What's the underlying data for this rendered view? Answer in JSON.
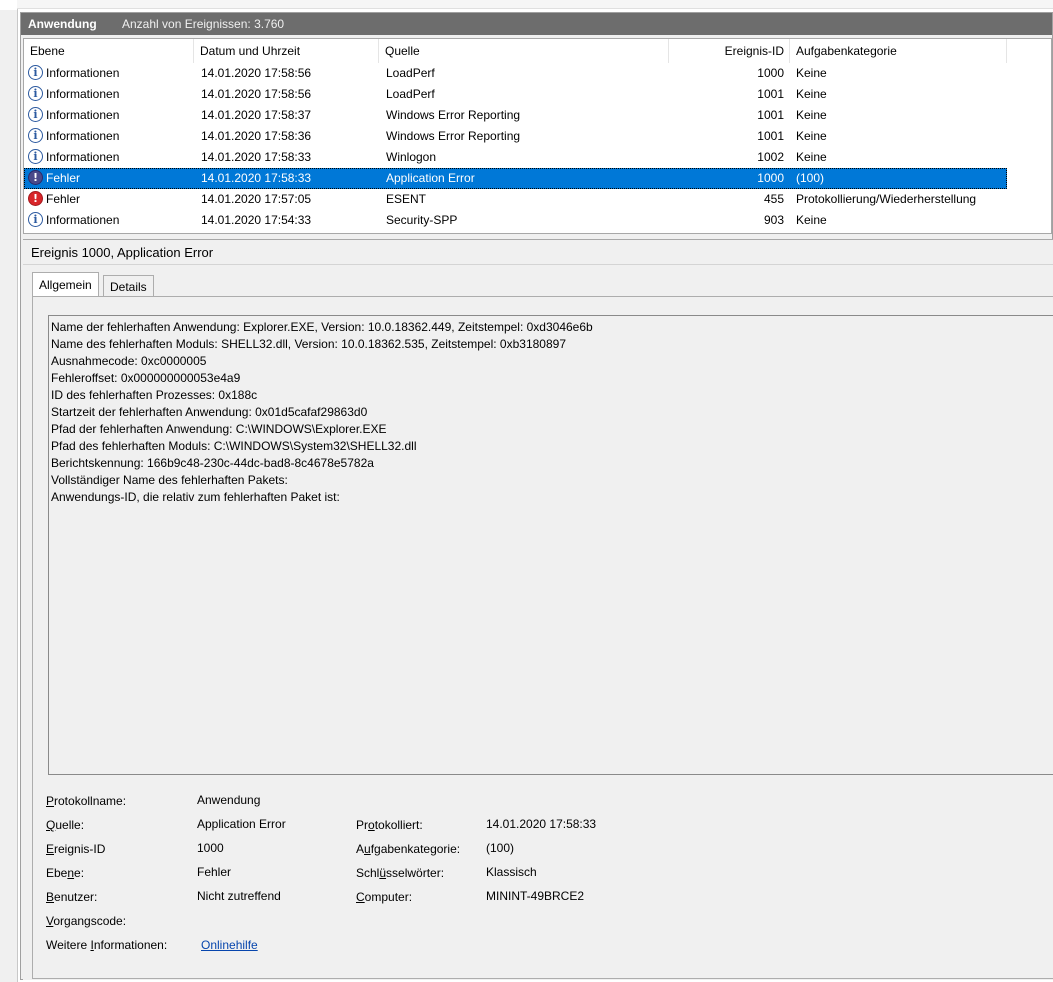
{
  "header": {
    "title": "Anwendung",
    "count_label": "Anzahl von Ereignissen: 3.760"
  },
  "columns": [
    "Ebene",
    "Datum und Uhrzeit",
    "Quelle",
    "Ereignis-ID",
    "Aufgabenkategorie"
  ],
  "rows": [
    {
      "level": "Informationen",
      "icon": "info-icon",
      "datetime": "14.01.2020 17:58:56",
      "source": "LoadPerf",
      "id": "1000",
      "category": "Keine"
    },
    {
      "level": "Informationen",
      "icon": "info-icon",
      "datetime": "14.01.2020 17:58:56",
      "source": "LoadPerf",
      "id": "1001",
      "category": "Keine"
    },
    {
      "level": "Informationen",
      "icon": "info-icon",
      "datetime": "14.01.2020 17:58:37",
      "source": "Windows Error Reporting",
      "id": "1001",
      "category": "Keine"
    },
    {
      "level": "Informationen",
      "icon": "info-icon",
      "datetime": "14.01.2020 17:58:36",
      "source": "Windows Error Reporting",
      "id": "1001",
      "category": "Keine"
    },
    {
      "level": "Informationen",
      "icon": "info-icon",
      "datetime": "14.01.2020 17:58:33",
      "source": "Winlogon",
      "id": "1002",
      "category": "Keine"
    },
    {
      "level": "Fehler",
      "icon": "error-icon",
      "datetime": "14.01.2020 17:58:33",
      "source": "Application Error",
      "id": "1000",
      "category": "(100)"
    },
    {
      "level": "Fehler",
      "icon": "error-icon",
      "datetime": "14.01.2020 17:57:05",
      "source": "ESENT",
      "id": "455",
      "category": "Protokollierung/Wiederherstellung"
    },
    {
      "level": "Informationen",
      "icon": "info-icon",
      "datetime": "14.01.2020 17:54:33",
      "source": "Security-SPP",
      "id": "903",
      "category": "Keine"
    }
  ],
  "details": {
    "title": "Ereignis 1000, Application Error",
    "tabs": [
      "Allgemein",
      "Details"
    ],
    "description": [
      "Name der fehlerhaften Anwendung: Explorer.EXE, Version: 10.0.18362.449, Zeitstempel: 0xd3046e6b",
      "Name des fehlerhaften Moduls: SHELL32.dll, Version: 10.0.18362.535, Zeitstempel: 0xb3180897",
      "Ausnahmecode: 0xc0000005",
      "Fehleroffset: 0x000000000053e4a9",
      "ID des fehlerhaften Prozesses: 0x188c",
      "Startzeit der fehlerhaften Anwendung: 0x01d5cafaf29863d0",
      "Pfad der fehlerhaften Anwendung: C:\\WINDOWS\\Explorer.EXE",
      "Pfad des fehlerhaften Moduls: C:\\WINDOWS\\System32\\SHELL32.dll",
      "Berichtskennung: 166b9c48-230c-44dc-bad8-8c4678e5782a",
      "Vollständiger Name des fehlerhaften Pakets:",
      "Anwendungs-ID, die relativ zum fehlerhaften Paket ist:"
    ],
    "fields": {
      "log_name_value": "Anwendung",
      "source_value": "Application Error",
      "event_id_value": "1000",
      "level_value": "Fehler",
      "user_value": "Nicht zutreffend",
      "logged_value": "14.01.2020 17:58:33",
      "task_category_value": "(100)",
      "keywords_value": "Klassisch",
      "computer_value": "MININT-49BRCE2",
      "more_info_link": "Onlinehilfe"
    }
  }
}
